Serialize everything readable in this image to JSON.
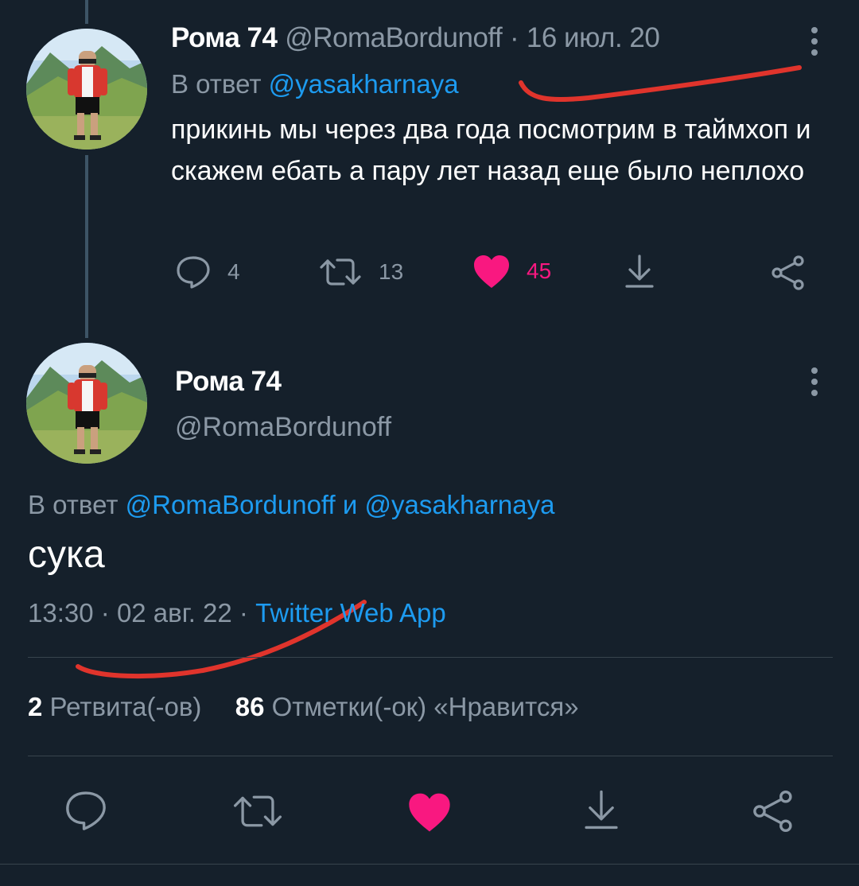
{
  "colors": {
    "background": "#15202b",
    "text_primary": "#ffffff",
    "text_secondary": "#8b98a5",
    "link": "#1d9bf0",
    "like": "#f91880",
    "divider": "#38444d",
    "annotation": "#e0342c"
  },
  "tweet1": {
    "author_name": "Рома 74",
    "author_handle": "@RomaBordunoff",
    "separator": "·",
    "date": "16 июл. 20",
    "reply_prefix": "В ответ",
    "reply_to": "@yasakharnaya",
    "text": "прикинь мы через два года посмотрим в таймхоп и скажем ебать а пару лет назад еще было неплохо",
    "replies": "4",
    "retweets": "13",
    "likes": "45",
    "icons": [
      "reply-icon",
      "retweet-icon",
      "heart-icon-filled",
      "download-icon",
      "share-icon",
      "more-icon"
    ]
  },
  "tweet2": {
    "author_name": "Рома 74",
    "author_handle": "@RomaBordunoff",
    "reply_prefix": "В ответ",
    "reply_to_1": "@RomaBordunoff",
    "reply_conjunction": "и",
    "reply_to_2": "@yasakharnaya",
    "text": "сука",
    "time": "13:30",
    "date": "02 авг. 22",
    "separator": "·",
    "source": "Twitter Web App",
    "retweet_count": "2",
    "retweet_label": "Ретвита(-ов)",
    "like_count": "86",
    "like_label": "Отметки(-ок) «Нравится»",
    "icons": [
      "reply-icon",
      "retweet-icon",
      "heart-icon-filled",
      "download-icon",
      "share-icon",
      "more-icon"
    ]
  }
}
